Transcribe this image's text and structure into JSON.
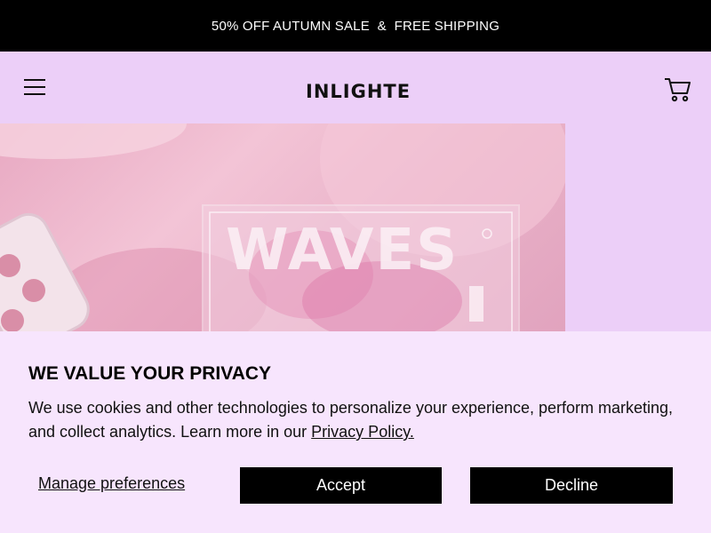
{
  "announcement": {
    "text": "50% OFF AUTUMN SALE  &  FREE SHIPPING"
  },
  "header": {
    "logo": "INLIGHTE",
    "menu_icon": "hamburger-menu-icon",
    "cart_icon": "shopping-cart-icon"
  },
  "hero": {
    "overlay_text": "WAVES"
  },
  "cookie_banner": {
    "title": "WE VALUE YOUR PRIVACY",
    "body": "We use cookies and other technologies to personalize your experience, perform marketing, and collect analytics. Learn more in our ",
    "policy_link": "Privacy Policy.",
    "manage_label": "Manage preferences",
    "accept_label": "Accept",
    "decline_label": "Decline"
  },
  "colors": {
    "header_bg": "#eccff8",
    "banner_bg": "#f7e5fd",
    "announcement_bg": "#000000",
    "button_bg": "#000000"
  }
}
